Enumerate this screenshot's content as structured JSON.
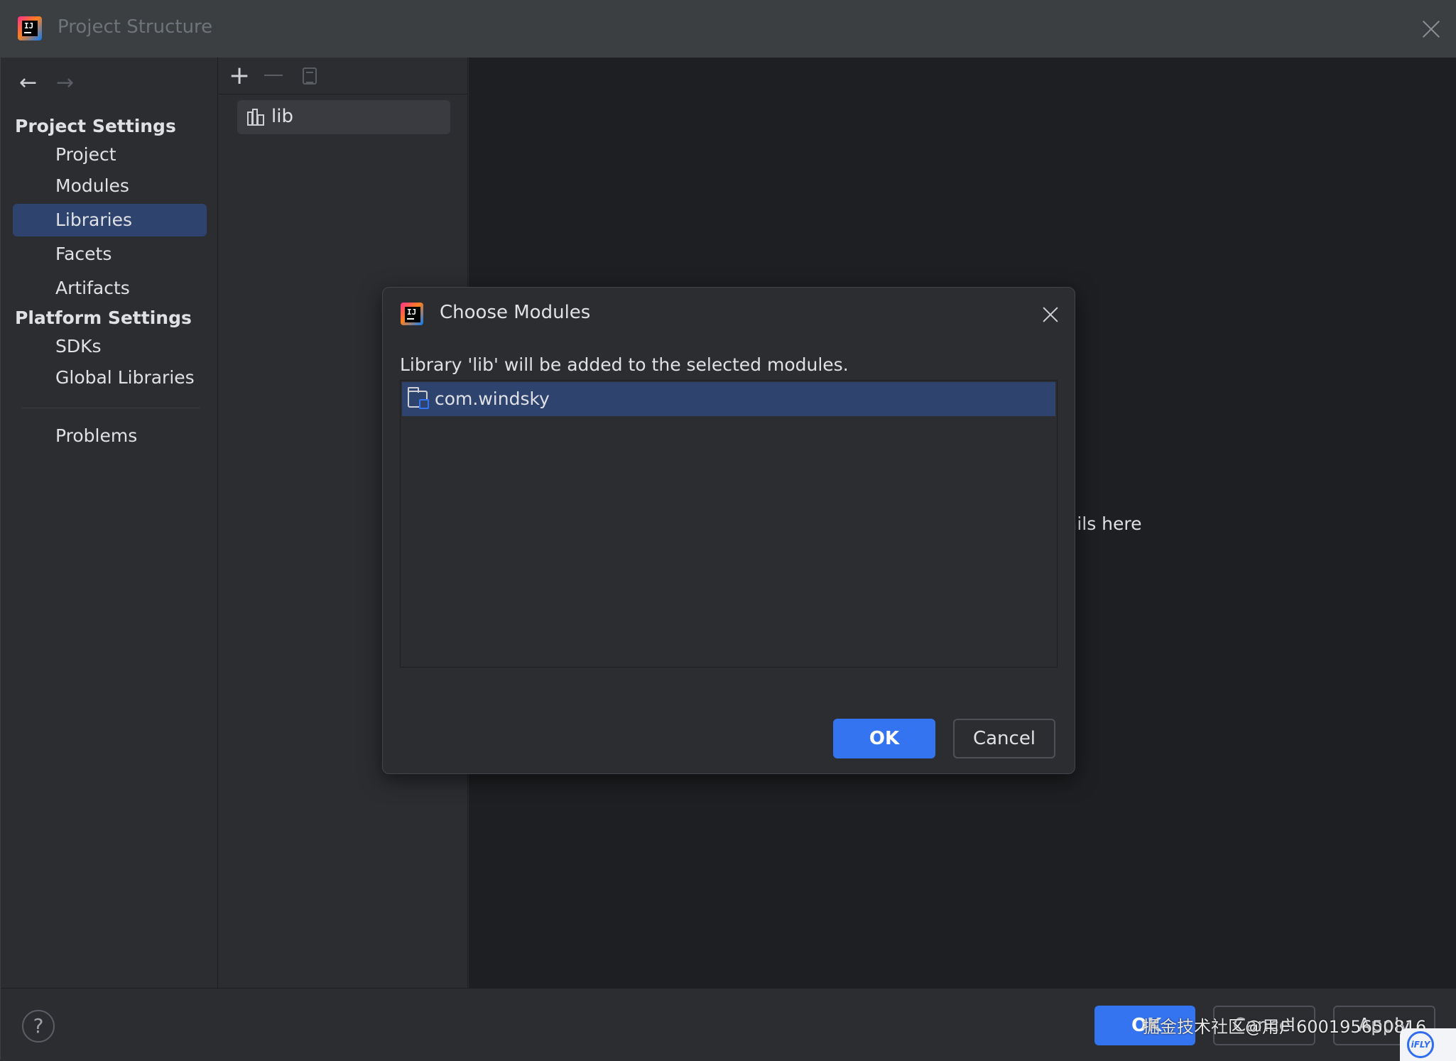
{
  "window": {
    "title": "Project Structure",
    "logo_text": "IJ"
  },
  "sidebar": {
    "project_settings_title": "Project Settings",
    "project_items": [
      {
        "label": "Project"
      },
      {
        "label": "Modules"
      },
      {
        "label": "Libraries",
        "selected": true
      },
      {
        "label": "Facets"
      },
      {
        "label": "Artifacts"
      }
    ],
    "platform_settings_title": "Platform Settings",
    "platform_items": [
      {
        "label": "SDKs"
      },
      {
        "label": "Global Libraries"
      }
    ],
    "problems_label": "Problems"
  },
  "libraries": {
    "items": [
      {
        "label": "lib"
      }
    ]
  },
  "detail": {
    "hint_text": "ails here"
  },
  "modal": {
    "title": "Choose Modules",
    "logo_text": "IJ",
    "message": "Library 'lib' will be added to the selected modules.",
    "modules": [
      {
        "label": "com.windsky"
      }
    ],
    "ok_label": "OK",
    "cancel_label": "Cancel"
  },
  "footer": {
    "help_label": "?",
    "ok_label": "OK",
    "cancel_label": "Cancel",
    "apply_label": "Apply",
    "watermark": "掘金技术社区@用户6001956",
    "watermark_suffix": "50816",
    "badge": "iFLY"
  },
  "colors": {
    "accent": "#3574f0",
    "selection": "#2e436e",
    "background": "#2b2d30",
    "detail_background": "#1e1f22"
  }
}
